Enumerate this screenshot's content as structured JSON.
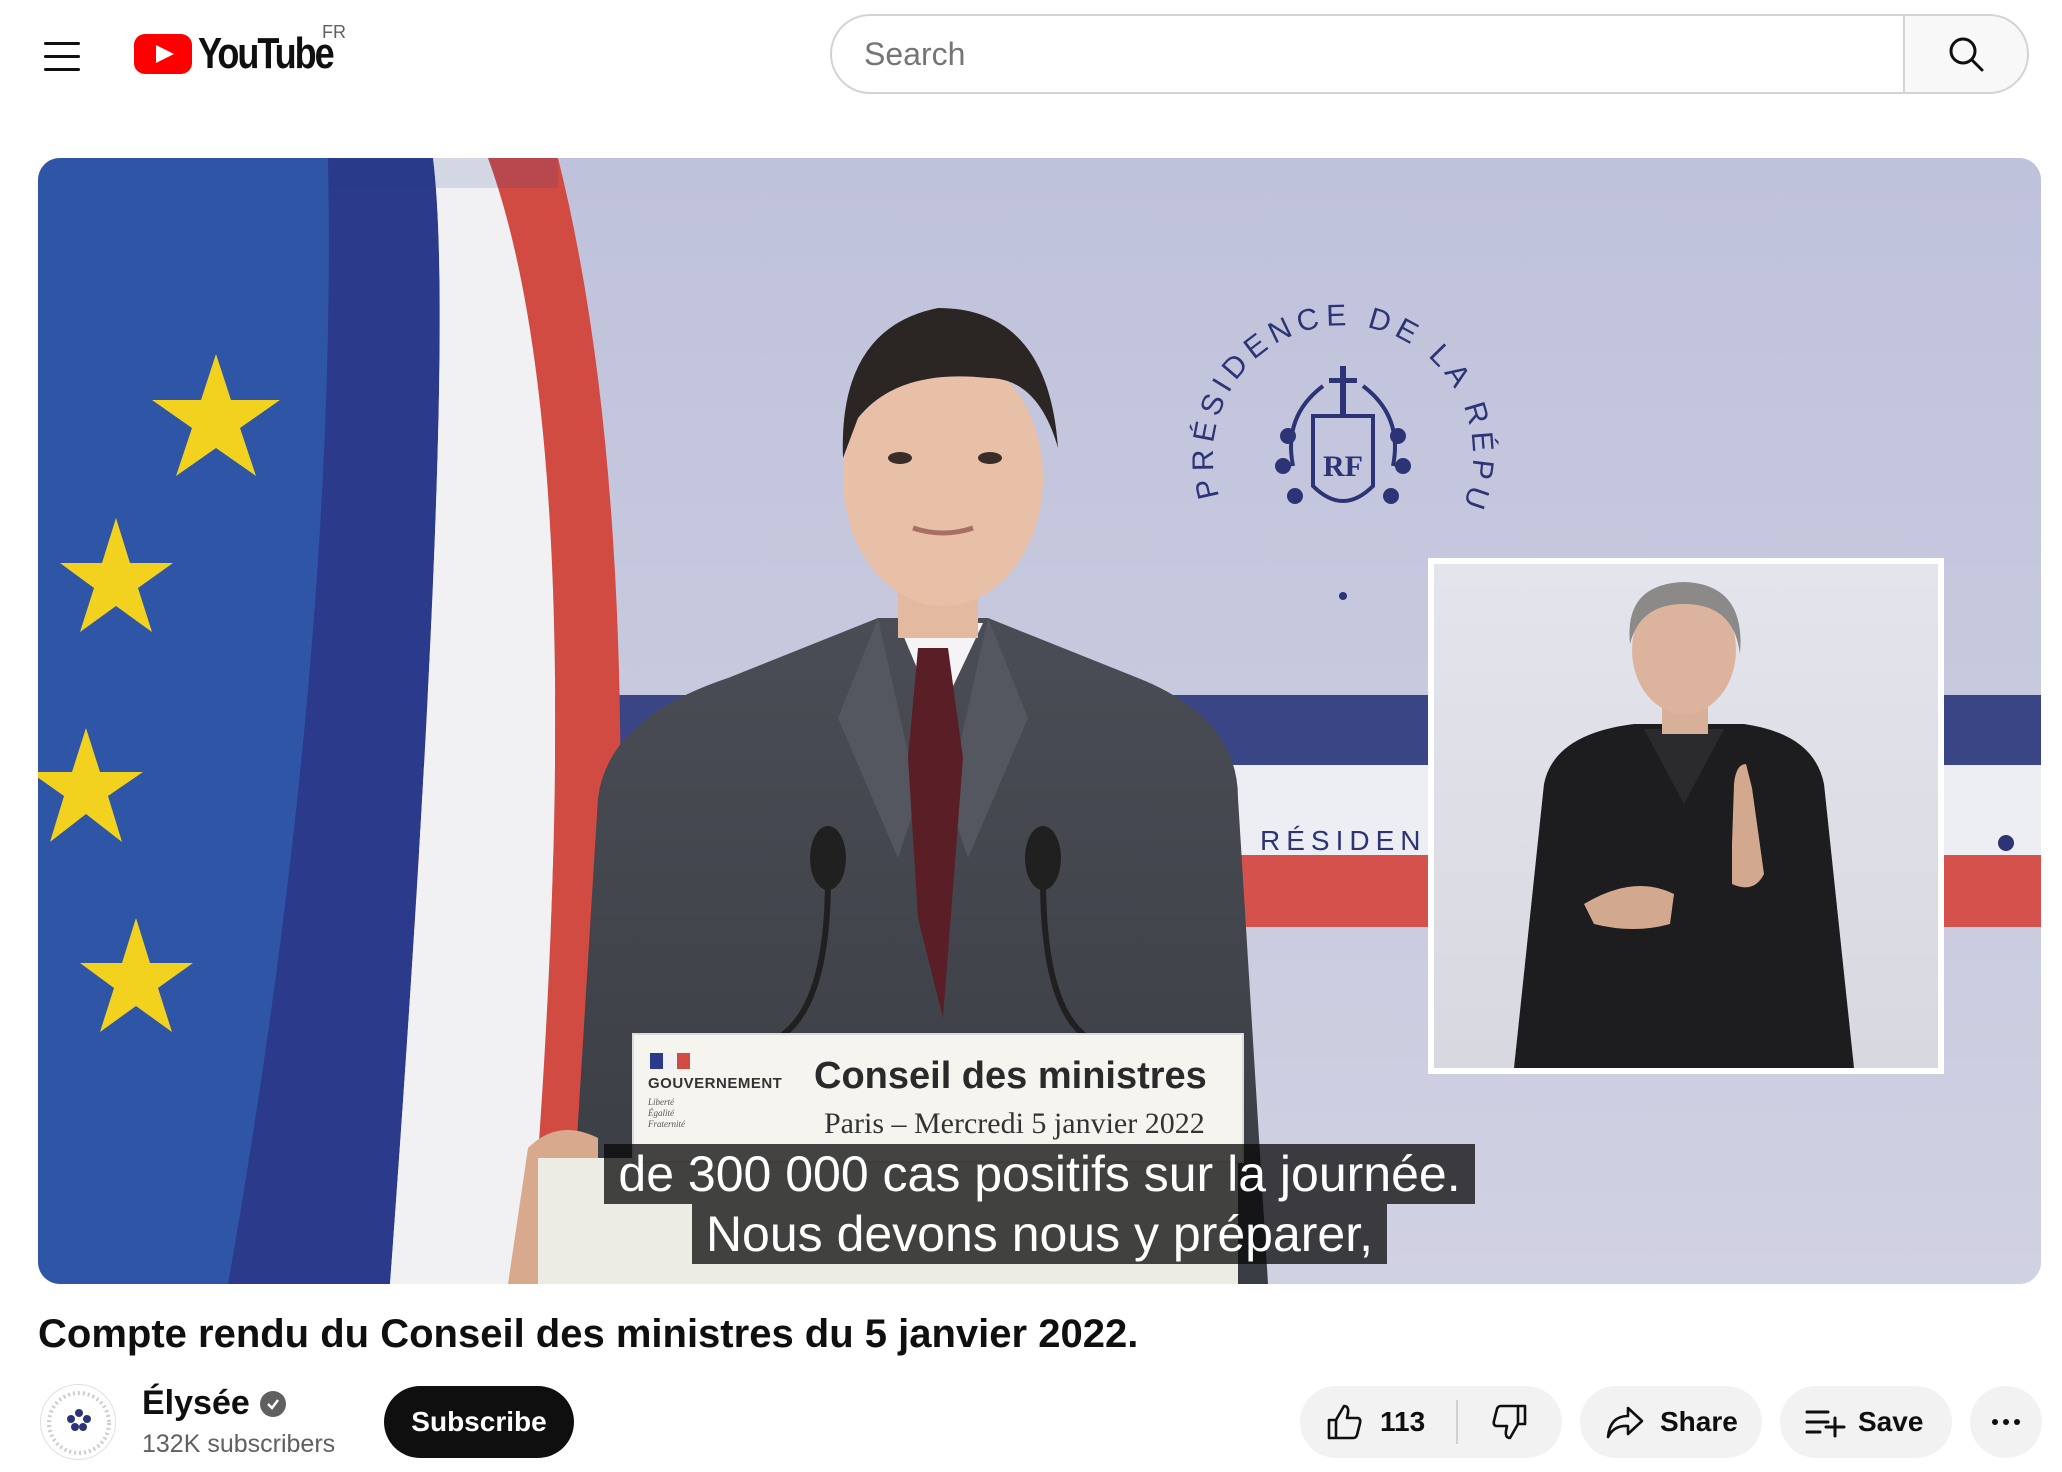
{
  "header": {
    "logo_text": "YouTube",
    "country_code": "FR",
    "search_placeholder": "Search"
  },
  "player": {
    "captions": [
      "de 300 000 cas positifs sur la journée.",
      "Nous devons nous y préparer,"
    ],
    "podium": {
      "gov_label": "GOUVERNEMENT",
      "gov_motto": [
        "Liberté",
        "Égalité",
        "Fraternité"
      ],
      "title": "Conseil des ministres",
      "subtitle": "Paris – Mercredi 5 janvier 2022"
    },
    "seal_text": "PRÉSIDENCE DE LA RÉPUBLIQUE",
    "seal_initials": "RF",
    "banner_text": "RÉSIDEN",
    "colors": {
      "bleu": "#2b3a8a",
      "blanc": "#f2f2f4",
      "rouge": "#d14b44",
      "background": "#c6c8dd"
    }
  },
  "video": {
    "title": "Compte rendu du Conseil des ministres du 5 janvier 2022."
  },
  "channel": {
    "name": "Élysée",
    "subscribers": "132K subscribers",
    "subscribe_label": "Subscribe",
    "verified": true
  },
  "actions": {
    "like_count": "113",
    "share_label": "Share",
    "save_label": "Save"
  },
  "icons": [
    "menu-icon",
    "youtube-logo-icon",
    "search-icon",
    "verified-icon",
    "thumbs-up-icon",
    "thumbs-down-icon",
    "share-icon",
    "playlist-add-icon",
    "more-icon"
  ]
}
